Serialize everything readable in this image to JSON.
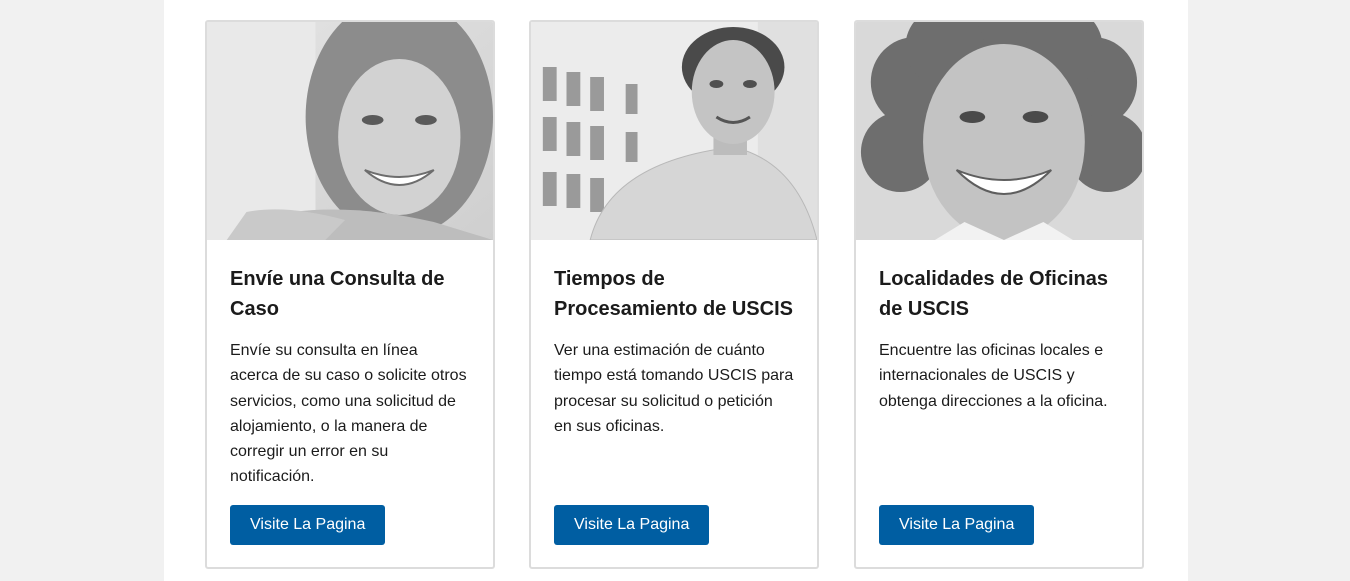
{
  "cards": [
    {
      "title": "Envíe una Consulta de Caso",
      "text": "Envíe su consulta en línea acerca de su caso o solicite otros servicios, como una solicitud de alojamiento, o la manera de corregir un error en su notificación.",
      "button_label": "Visite La Pagina",
      "photo": "woman-smiling-photo"
    },
    {
      "title": "Tiempos de Procesamiento de USCIS",
      "text": "Ver una estimación de cuánto tiempo está tomando USCIS para procesar su solicitud o petición en sus oficinas.",
      "button_label": "Visite La Pagina",
      "photo": "man-smiling-photo"
    },
    {
      "title": "Localidades de Oficinas de USCIS",
      "text": "Encuentre las oficinas locales e internacionales de USCIS y obtenga direcciones a la oficina.",
      "button_label": "Visite La Pagina",
      "photo": "older-woman-smiling-photo"
    }
  ],
  "colors": {
    "button_bg": "#005ea2",
    "button_text": "#ffffff",
    "border": "#dcdcdc",
    "page_bg": "#f1f1f1"
  }
}
